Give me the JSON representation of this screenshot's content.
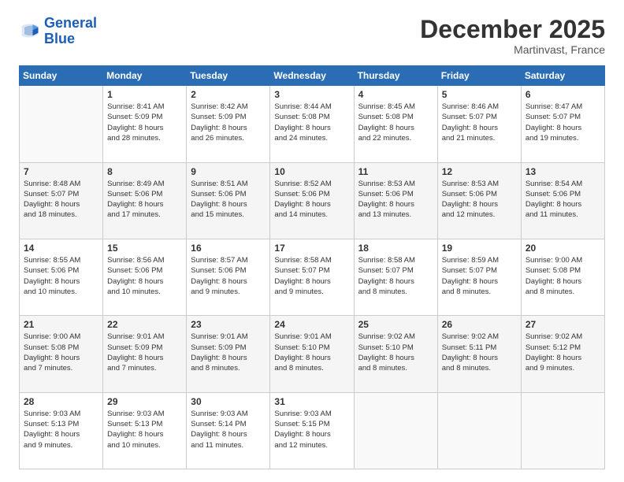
{
  "logo": {
    "line1": "General",
    "line2": "Blue"
  },
  "title": "December 2025",
  "subtitle": "Martinvast, France",
  "days_header": [
    "Sunday",
    "Monday",
    "Tuesday",
    "Wednesday",
    "Thursday",
    "Friday",
    "Saturday"
  ],
  "weeks": [
    [
      {
        "day": "",
        "info": ""
      },
      {
        "day": "1",
        "info": "Sunrise: 8:41 AM\nSunset: 5:09 PM\nDaylight: 8 hours\nand 28 minutes."
      },
      {
        "day": "2",
        "info": "Sunrise: 8:42 AM\nSunset: 5:09 PM\nDaylight: 8 hours\nand 26 minutes."
      },
      {
        "day": "3",
        "info": "Sunrise: 8:44 AM\nSunset: 5:08 PM\nDaylight: 8 hours\nand 24 minutes."
      },
      {
        "day": "4",
        "info": "Sunrise: 8:45 AM\nSunset: 5:08 PM\nDaylight: 8 hours\nand 22 minutes."
      },
      {
        "day": "5",
        "info": "Sunrise: 8:46 AM\nSunset: 5:07 PM\nDaylight: 8 hours\nand 21 minutes."
      },
      {
        "day": "6",
        "info": "Sunrise: 8:47 AM\nSunset: 5:07 PM\nDaylight: 8 hours\nand 19 minutes."
      }
    ],
    [
      {
        "day": "7",
        "info": "Sunrise: 8:48 AM\nSunset: 5:07 PM\nDaylight: 8 hours\nand 18 minutes."
      },
      {
        "day": "8",
        "info": "Sunrise: 8:49 AM\nSunset: 5:06 PM\nDaylight: 8 hours\nand 17 minutes."
      },
      {
        "day": "9",
        "info": "Sunrise: 8:51 AM\nSunset: 5:06 PM\nDaylight: 8 hours\nand 15 minutes."
      },
      {
        "day": "10",
        "info": "Sunrise: 8:52 AM\nSunset: 5:06 PM\nDaylight: 8 hours\nand 14 minutes."
      },
      {
        "day": "11",
        "info": "Sunrise: 8:53 AM\nSunset: 5:06 PM\nDaylight: 8 hours\nand 13 minutes."
      },
      {
        "day": "12",
        "info": "Sunrise: 8:53 AM\nSunset: 5:06 PM\nDaylight: 8 hours\nand 12 minutes."
      },
      {
        "day": "13",
        "info": "Sunrise: 8:54 AM\nSunset: 5:06 PM\nDaylight: 8 hours\nand 11 minutes."
      }
    ],
    [
      {
        "day": "14",
        "info": "Sunrise: 8:55 AM\nSunset: 5:06 PM\nDaylight: 8 hours\nand 10 minutes."
      },
      {
        "day": "15",
        "info": "Sunrise: 8:56 AM\nSunset: 5:06 PM\nDaylight: 8 hours\nand 10 minutes."
      },
      {
        "day": "16",
        "info": "Sunrise: 8:57 AM\nSunset: 5:06 PM\nDaylight: 8 hours\nand 9 minutes."
      },
      {
        "day": "17",
        "info": "Sunrise: 8:58 AM\nSunset: 5:07 PM\nDaylight: 8 hours\nand 9 minutes."
      },
      {
        "day": "18",
        "info": "Sunrise: 8:58 AM\nSunset: 5:07 PM\nDaylight: 8 hours\nand 8 minutes."
      },
      {
        "day": "19",
        "info": "Sunrise: 8:59 AM\nSunset: 5:07 PM\nDaylight: 8 hours\nand 8 minutes."
      },
      {
        "day": "20",
        "info": "Sunrise: 9:00 AM\nSunset: 5:08 PM\nDaylight: 8 hours\nand 8 minutes."
      }
    ],
    [
      {
        "day": "21",
        "info": "Sunrise: 9:00 AM\nSunset: 5:08 PM\nDaylight: 8 hours\nand 7 minutes."
      },
      {
        "day": "22",
        "info": "Sunrise: 9:01 AM\nSunset: 5:09 PM\nDaylight: 8 hours\nand 7 minutes."
      },
      {
        "day": "23",
        "info": "Sunrise: 9:01 AM\nSunset: 5:09 PM\nDaylight: 8 hours\nand 8 minutes."
      },
      {
        "day": "24",
        "info": "Sunrise: 9:01 AM\nSunset: 5:10 PM\nDaylight: 8 hours\nand 8 minutes."
      },
      {
        "day": "25",
        "info": "Sunrise: 9:02 AM\nSunset: 5:10 PM\nDaylight: 8 hours\nand 8 minutes."
      },
      {
        "day": "26",
        "info": "Sunrise: 9:02 AM\nSunset: 5:11 PM\nDaylight: 8 hours\nand 8 minutes."
      },
      {
        "day": "27",
        "info": "Sunrise: 9:02 AM\nSunset: 5:12 PM\nDaylight: 8 hours\nand 9 minutes."
      }
    ],
    [
      {
        "day": "28",
        "info": "Sunrise: 9:03 AM\nSunset: 5:13 PM\nDaylight: 8 hours\nand 9 minutes."
      },
      {
        "day": "29",
        "info": "Sunrise: 9:03 AM\nSunset: 5:13 PM\nDaylight: 8 hours\nand 10 minutes."
      },
      {
        "day": "30",
        "info": "Sunrise: 9:03 AM\nSunset: 5:14 PM\nDaylight: 8 hours\nand 11 minutes."
      },
      {
        "day": "31",
        "info": "Sunrise: 9:03 AM\nSunset: 5:15 PM\nDaylight: 8 hours\nand 12 minutes."
      },
      {
        "day": "",
        "info": ""
      },
      {
        "day": "",
        "info": ""
      },
      {
        "day": "",
        "info": ""
      }
    ]
  ]
}
